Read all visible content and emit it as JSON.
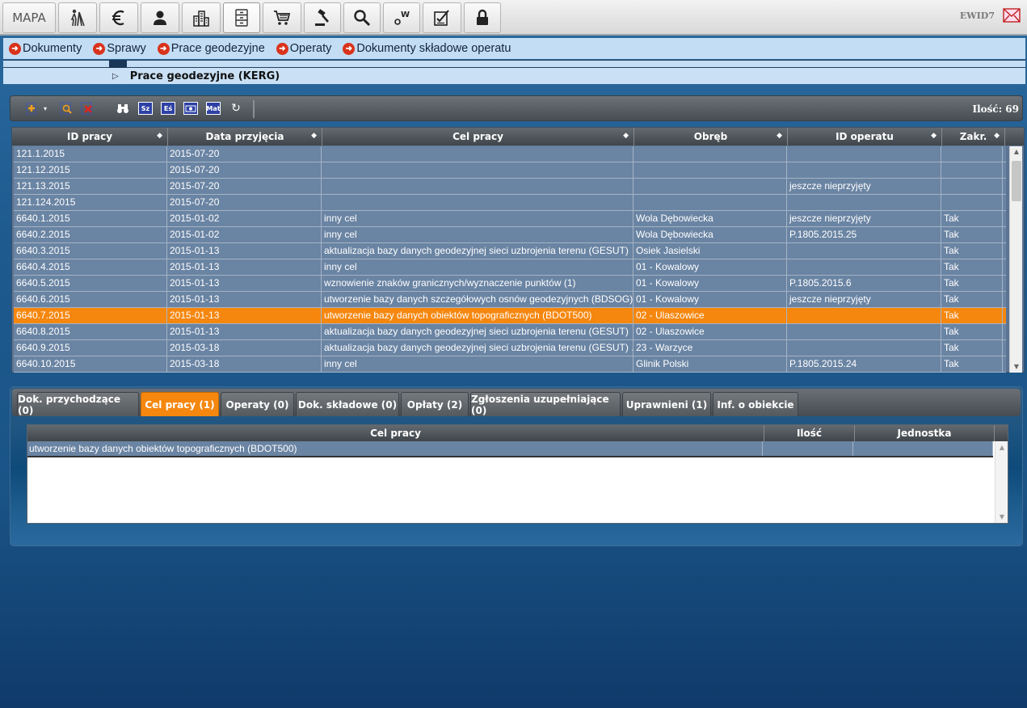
{
  "toolbar": {
    "map_label": "MAPA",
    "app_name": "EWID7",
    "buttons": [
      "surveyor-icon",
      "euro-icon",
      "person-icon",
      "buildings-icon",
      "cabinet-icon",
      "cart-icon",
      "gavel-icon",
      "search-icon",
      "weight-icon",
      "checklist-icon",
      "lock-icon"
    ]
  },
  "nav": {
    "links": [
      "Dokumenty",
      "Sprawy",
      "Prace geodezyjne",
      "Operaty",
      "Dokumenty składowe operatu"
    ],
    "breadcrumb": "Prace geodezyjne (KERG)"
  },
  "grid_toolbar": {
    "tools": [
      "Sz",
      "Eś",
      "Mat"
    ],
    "count_label": "Ilość: 69"
  },
  "grid": {
    "columns": [
      "ID pracy",
      "Data przyjęcia",
      "Cel pracy",
      "Obręb",
      "ID operatu",
      "Zakr."
    ],
    "selected_index": 10,
    "rows": [
      [
        "121.1.2015",
        "2015-07-20",
        "",
        "",
        "",
        ""
      ],
      [
        "121.12.2015",
        "2015-07-20",
        "",
        "",
        "",
        ""
      ],
      [
        "121.13.2015",
        "2015-07-20",
        "",
        "",
        "jeszcze nieprzyjęty",
        ""
      ],
      [
        "121.124.2015",
        "2015-07-20",
        "",
        "",
        "",
        ""
      ],
      [
        "6640.1.2015",
        "2015-01-02",
        "inny cel",
        "Wola Dębowiecka",
        "jeszcze nieprzyjęty",
        "Tak"
      ],
      [
        "6640.2.2015",
        "2015-01-02",
        "inny cel",
        "Wola Dębowiecka",
        "P.1805.2015.25",
        "Tak"
      ],
      [
        "6640.3.2015",
        "2015-01-13",
        "aktualizacja bazy danych geodezyjnej sieci uzbrojenia terenu (GESUT)",
        "Osiek Jasielski",
        "",
        "Tak"
      ],
      [
        "6640.4.2015",
        "2015-01-13",
        "inny cel",
        "01 - Kowalowy",
        "",
        "Tak"
      ],
      [
        "6640.5.2015",
        "2015-01-13",
        "wznowienie znaków granicznych/wyznaczenie punktów (1)",
        "01 - Kowalowy",
        "P.1805.2015.6",
        "Tak"
      ],
      [
        "6640.6.2015",
        "2015-01-13",
        "utworzenie bazy danych szczegółowych osnów geodezyjnych (BDSOG)",
        "01 - Kowalowy",
        "jeszcze nieprzyjęty",
        "Tak"
      ],
      [
        "6640.7.2015",
        "2015-01-13",
        "utworzenie bazy danych obiektów topograficznych (BDOT500)",
        "02 - Ulaszowice",
        "",
        "Tak"
      ],
      [
        "6640.8.2015",
        "2015-01-13",
        "aktualizacja bazy danych geodezyjnej sieci uzbrojenia terenu (GESUT)",
        "02 - Ulaszowice",
        "",
        "Tak"
      ],
      [
        "6640.9.2015",
        "2015-03-18",
        "aktualizacja bazy danych geodezyjnej sieci uzbrojenia terenu (GESUT) ...",
        "23 - Warzyce",
        "",
        "Tak"
      ],
      [
        "6640.10.2015",
        "2015-03-18",
        "inny cel",
        "Glinik Polski",
        "P.1805.2015.24",
        "Tak"
      ]
    ]
  },
  "tabs": {
    "items": [
      "Dok. przychodzące (0)",
      "Cel pracy (1)",
      "Operaty (0)",
      "Dok. składowe (0)",
      "Opłaty (2)",
      "Zgłoszenia uzupełniające (0)",
      "Uprawnieni (1)",
      "Inf. o obiekcie"
    ],
    "active_index": 1
  },
  "subgrid": {
    "columns": [
      "Cel pracy",
      "Ilość",
      "Jednostka"
    ],
    "rows": [
      [
        "utworzenie bazy danych obiektów topograficznych (BDOT500)",
        "",
        ""
      ]
    ]
  },
  "colors": {
    "selected_row": "#f5870f",
    "row_bg": "#6a84a3",
    "nav_bg": "#c3ddf4",
    "nav_arrow": "#d9331c"
  }
}
